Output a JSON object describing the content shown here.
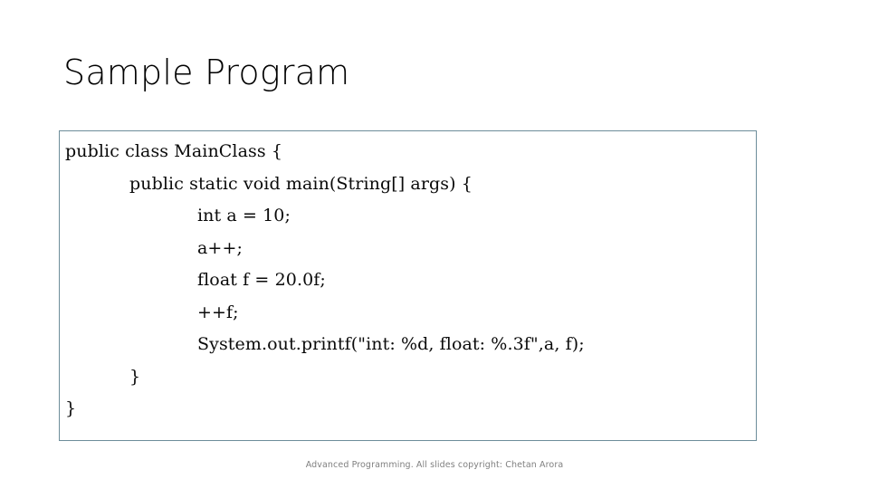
{
  "slide": {
    "title": "Sample Program",
    "background_color": "#FFFFFF",
    "title_color": "#000000"
  },
  "code_block": {
    "border_color": "#6D8D9A",
    "background_color": "#FFFFFF",
    "text_color": "#0A0A0A",
    "language": "java",
    "lines": [
      {
        "indent": 0,
        "text": "public class MainClass {"
      },
      {
        "indent": 1,
        "text": "public static void main(String[] args) {"
      },
      {
        "indent": 2,
        "text": "int a = 10;"
      },
      {
        "indent": 2,
        "text": "a++;"
      },
      {
        "indent": 2,
        "text": "float f = 20.0f;"
      },
      {
        "indent": 2,
        "text": "++f;"
      },
      {
        "indent": 2,
        "text": "System.out.printf(\"int: %d, float: %.3f\",a, f);"
      },
      {
        "indent": 1,
        "text": "}"
      },
      {
        "indent": 0,
        "text": "}"
      }
    ]
  },
  "footer": {
    "text": "Advanced Programming. All slides copyright: Chetan Arora",
    "color": "#808080"
  }
}
